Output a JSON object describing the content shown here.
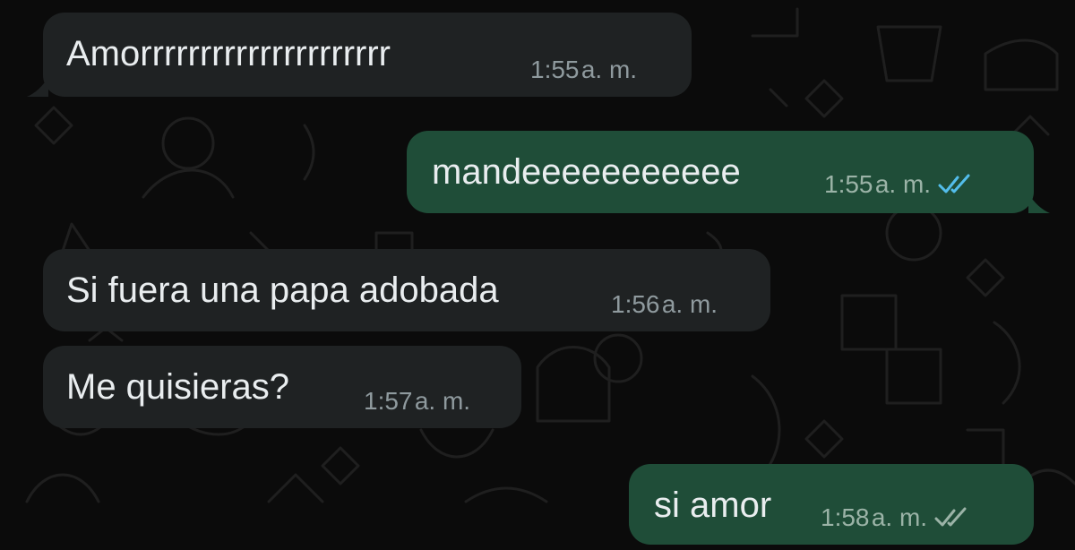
{
  "chat": {
    "messages": [
      {
        "direction": "in",
        "text": "Amorrrrrrrrrrrrrrrrrrrrr",
        "time": "1:55 a. m."
      },
      {
        "direction": "out",
        "text": "mandeeeeeeeeeee",
        "time": "1:55 a. m.",
        "status": "read"
      },
      {
        "direction": "in",
        "text": "Si fuera una papa adobada",
        "time": "1:56 a. m."
      },
      {
        "direction": "in",
        "text": "Me quisieras?",
        "time": "1:57 a. m."
      },
      {
        "direction": "out",
        "text": "si amor",
        "time": "1:58 a. m.",
        "status": "delivered"
      }
    ]
  },
  "colors": {
    "background": "#0b0b0b",
    "incoming_bubble": "#1f2223",
    "outgoing_bubble": "#1f4d38",
    "read_tick": "#53bdeb",
    "delivered_tick": "#9bb3a7"
  }
}
